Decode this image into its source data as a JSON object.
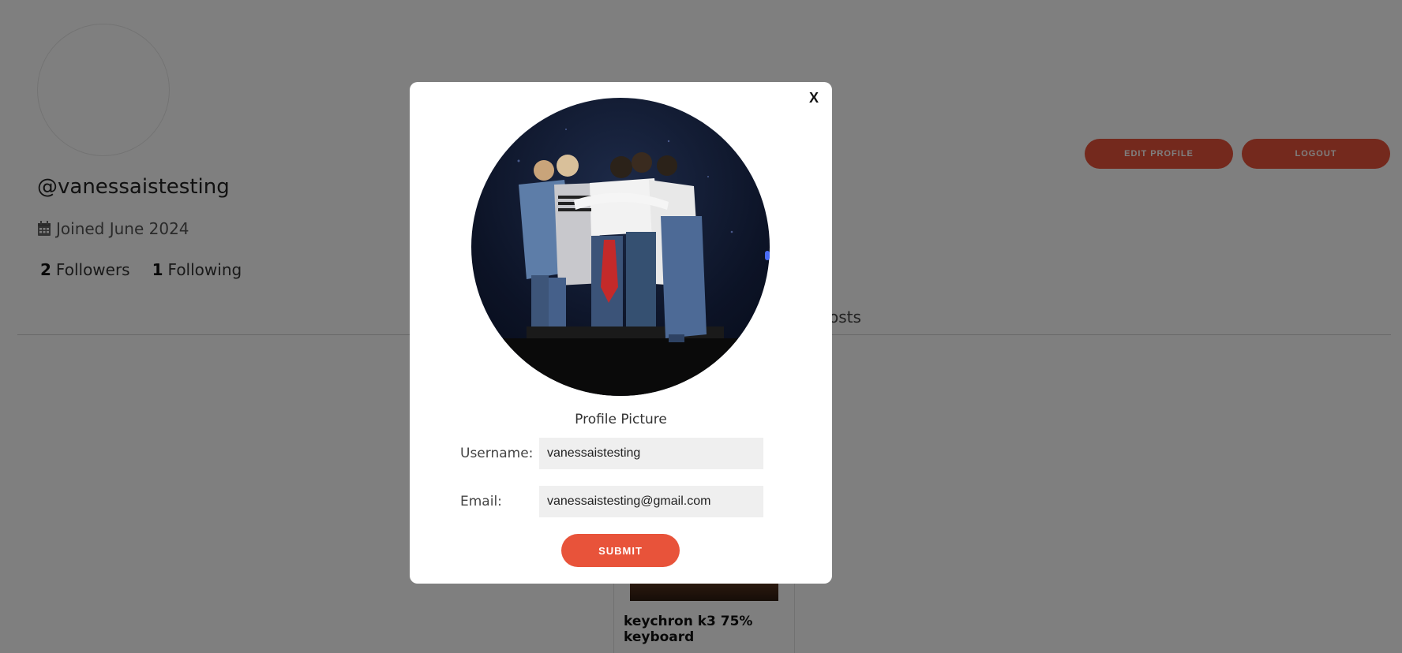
{
  "profile": {
    "handle": "@vanessaistesting",
    "joined": "Joined June 2024",
    "followers_count": "2",
    "followers_label": "Followers",
    "following_count": "1",
    "following_label": "Following"
  },
  "actions": {
    "edit_profile_label": "EDIT PROFILE",
    "logout_label": "LOGOUT"
  },
  "tabs": {
    "posts_fragment": "osts"
  },
  "section": {
    "heading_fragment": "s"
  },
  "posts": [
    {
      "title": "keychron k3 75% keyboard"
    }
  ],
  "modal": {
    "close_label": "X",
    "photo_label": "Profile Picture",
    "username_label": "Username:",
    "username_value": "vanessaistesting",
    "email_label": "Email:",
    "email_value": "vanessaistesting@gmail.com",
    "submit_label": "SUBMIT"
  },
  "colors": {
    "accent": "#e8533a",
    "overlay": "rgba(0,0,0,0.5)",
    "section_heading": "#e8792a"
  },
  "icons": {
    "calendar": "calendar-icon"
  }
}
